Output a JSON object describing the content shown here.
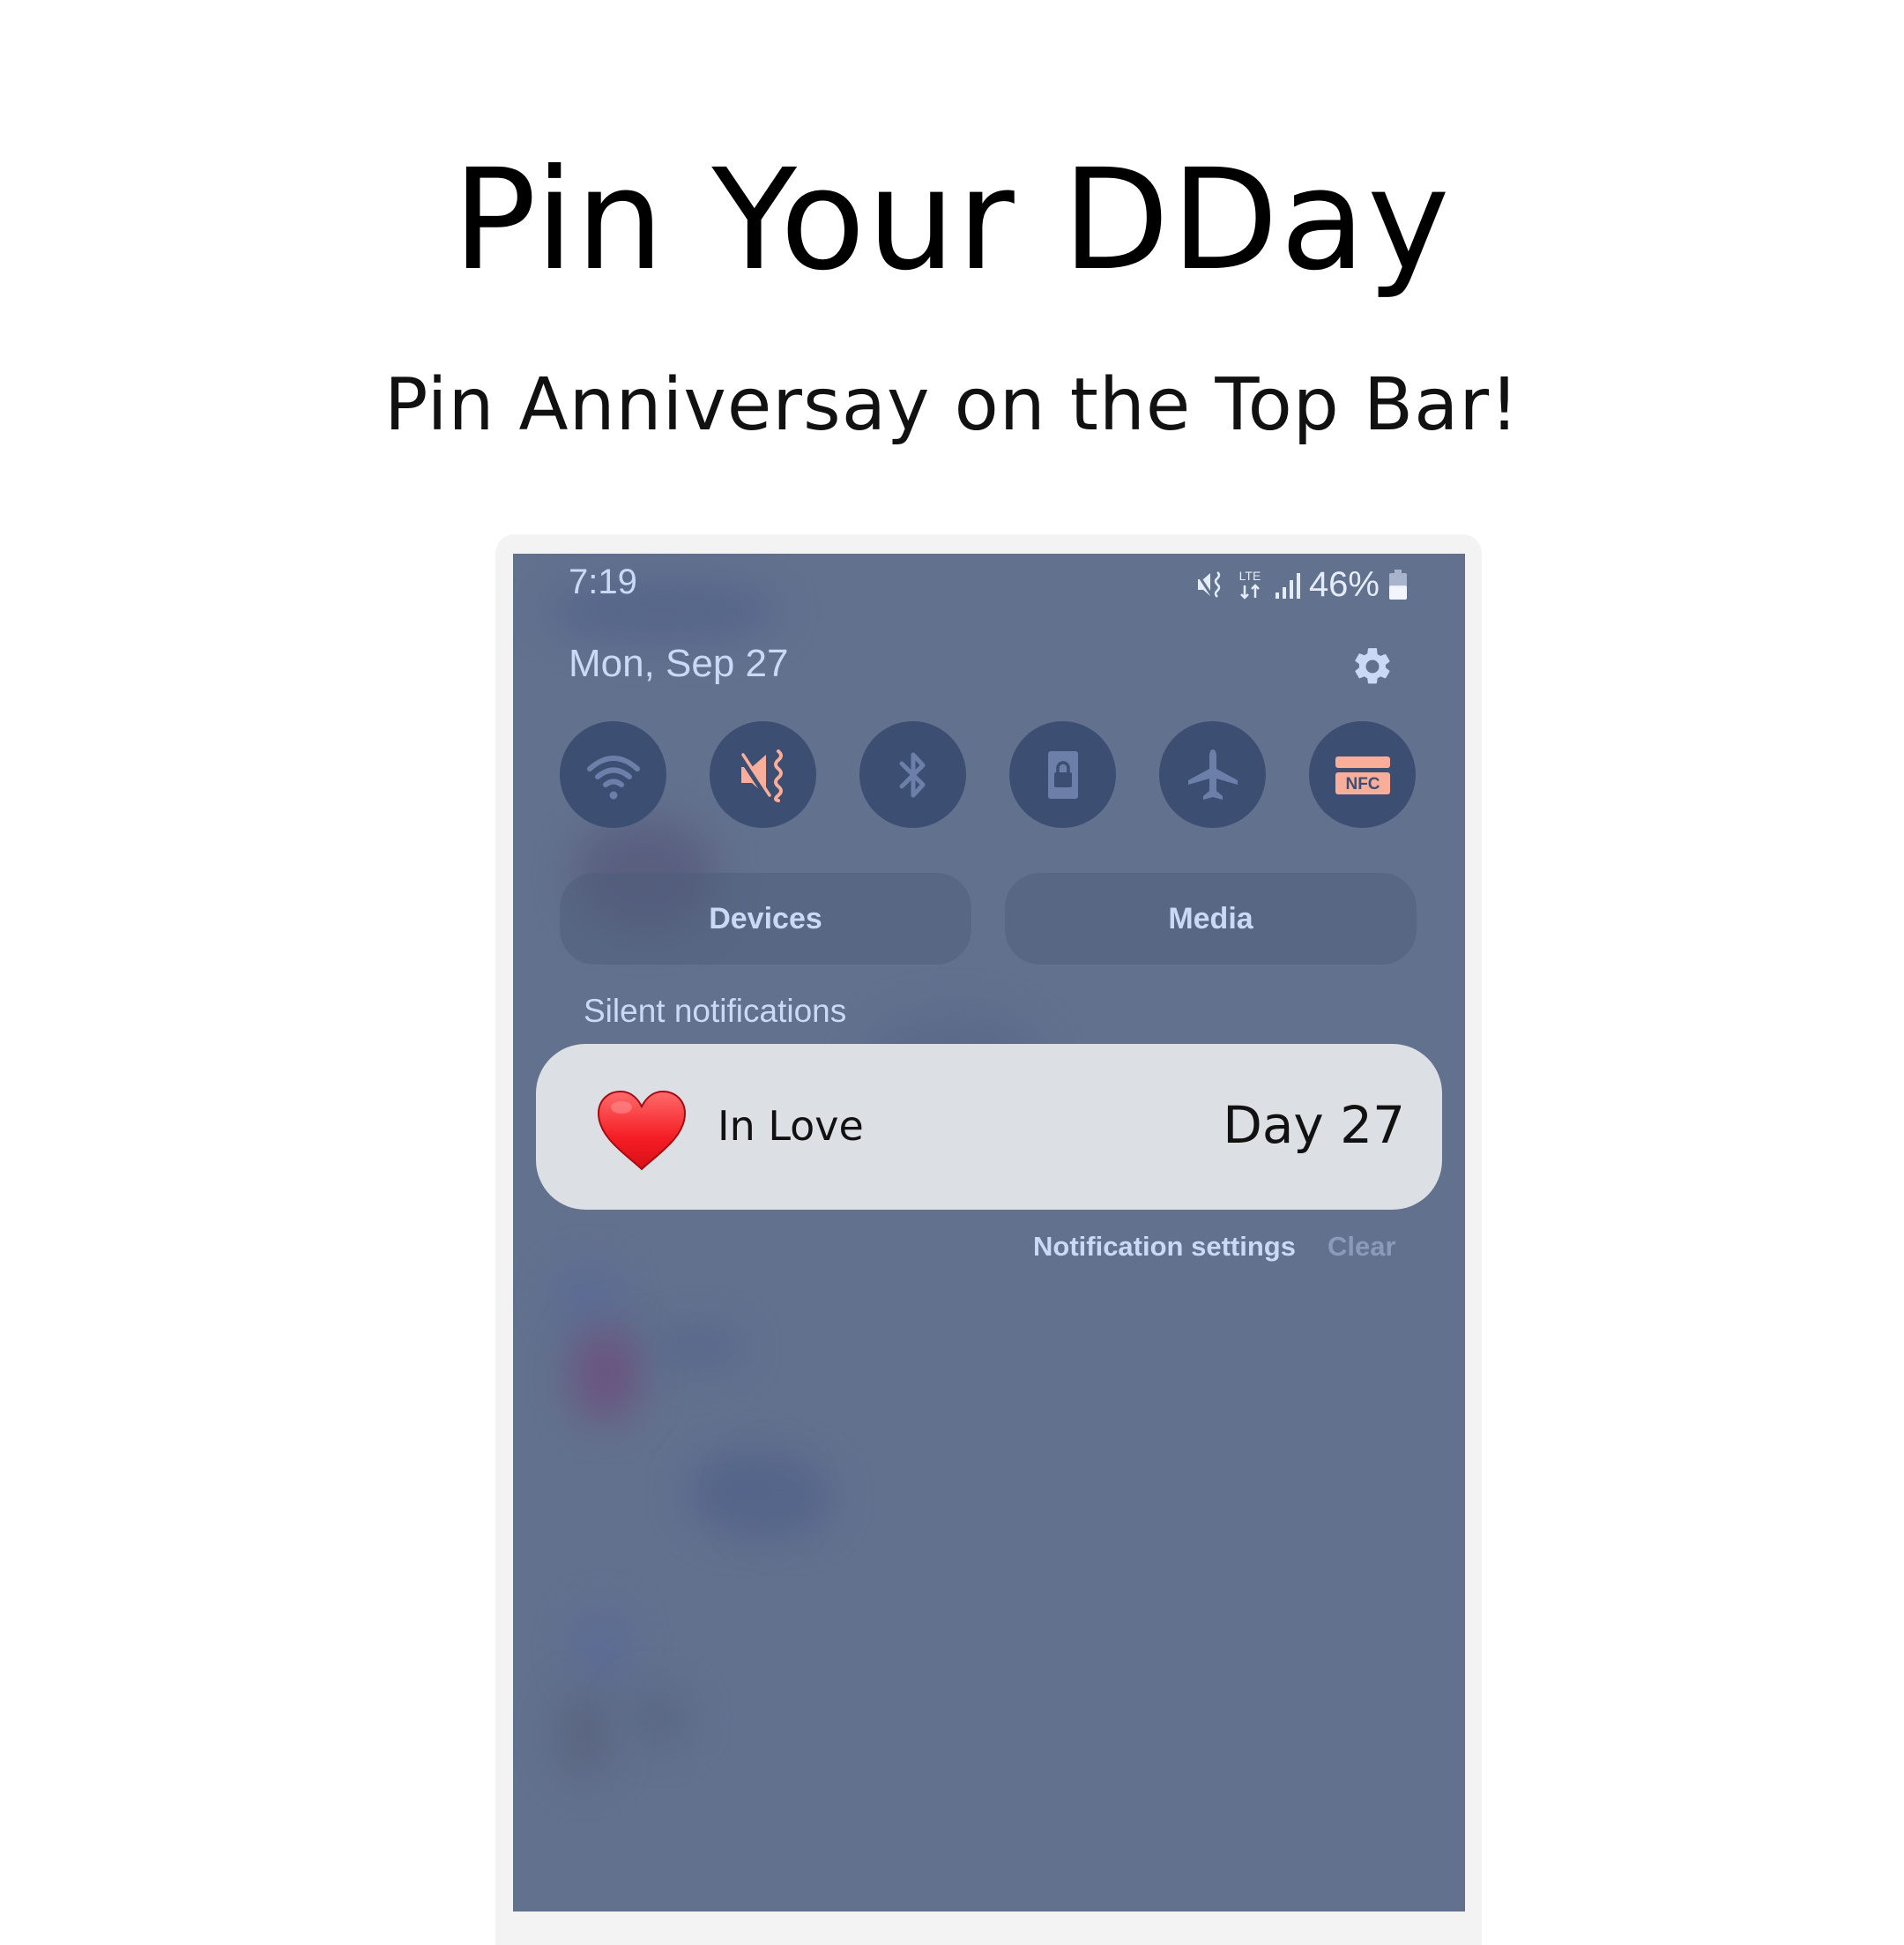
{
  "promo": {
    "headline": "Pin Your DDay",
    "subline": "Pin Anniversay on the Top Bar!"
  },
  "status_bar": {
    "time": "7:19",
    "icons": [
      "mute-vibrate-icon",
      "lte-icon",
      "signal-icon"
    ],
    "lte_label": "LTE",
    "battery_percent_label": "46%",
    "battery_level": 0.46
  },
  "header": {
    "date": "Mon, Sep 27",
    "settings_icon": "gear-icon"
  },
  "quick_toggles": [
    {
      "name": "wifi",
      "icon": "wifi-icon",
      "active": false
    },
    {
      "name": "sound",
      "icon": "mute-vibrate-icon",
      "active": true
    },
    {
      "name": "bluetooth",
      "icon": "bluetooth-icon",
      "active": false
    },
    {
      "name": "screen-lock",
      "icon": "rotation-lock-icon",
      "active": false
    },
    {
      "name": "airplane-mode",
      "icon": "airplane-icon",
      "active": false
    },
    {
      "name": "nfc",
      "icon": "nfc-icon",
      "label": "NFC",
      "active": true
    }
  ],
  "panel_buttons": {
    "devices": "Devices",
    "media": "Media"
  },
  "notifications": {
    "section_label": "Silent notifications",
    "items": [
      {
        "icon": "heart-icon",
        "title": "In Love",
        "value": "Day 27"
      }
    ],
    "settings_label": "Notification settings",
    "clear_label": "Clear"
  },
  "colors": {
    "panel_bg": "#62718e",
    "toggle_bg": "#3c4e72",
    "toggle_inactive_icon": "#6b7fa8",
    "toggle_active_icon": "#f9ae9b",
    "accent_text": "#c8daf5",
    "card_bg": "#dcdfe3"
  }
}
